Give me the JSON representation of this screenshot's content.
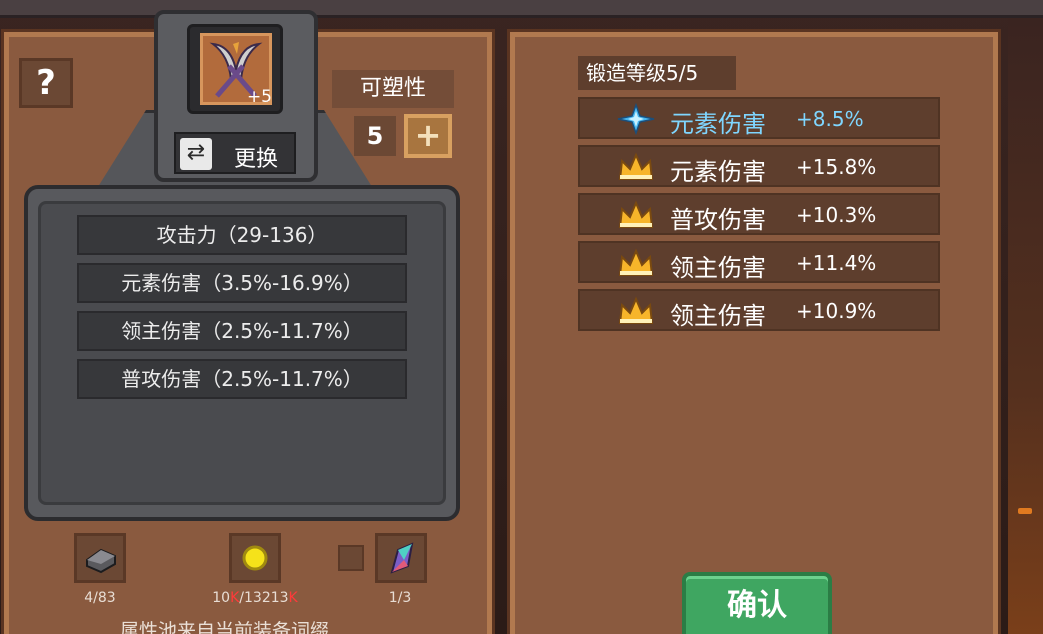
{
  "help": {
    "label": "?"
  },
  "item": {
    "level_badge": "+5",
    "icon": "crossed-scythes-icon"
  },
  "swap": {
    "label": "更换",
    "icon": "swap-arrows-icon"
  },
  "plasticity": {
    "label": "可塑性",
    "value": "5",
    "add_label": "+"
  },
  "attributes": [
    "攻击力（29-136）",
    "元素伤害（3.5%-16.9%）",
    "领主伤害（2.5%-11.7%）",
    "普攻伤害（2.5%-11.7%）"
  ],
  "materials": [
    {
      "icon": "iron-ingot-icon",
      "count": "4/83"
    },
    {
      "icon": "gold-coin-icon",
      "count_main": "10",
      "count_k1": "K",
      "count_mid": "/13213",
      "count_k2": "K"
    },
    {
      "icon": "crystal-icon",
      "count": "1/3"
    }
  ],
  "pool_text": "属性池来自当前装备词缀",
  "forge": {
    "level_label": "锻造等级5/5",
    "bonuses": [
      {
        "icon": "blue-star-icon",
        "name": "元素伤害",
        "value": "+8.5%",
        "color": "#7fd6ff"
      },
      {
        "icon": "crown-icon",
        "name": "元素伤害",
        "value": "+15.8%",
        "color": "#ffffff"
      },
      {
        "icon": "crown-icon",
        "name": "普攻伤害",
        "value": "+10.3%",
        "color": "#ffffff"
      },
      {
        "icon": "crown-icon",
        "name": "领主伤害",
        "value": "+11.4%",
        "color": "#ffffff"
      },
      {
        "icon": "crown-icon",
        "name": "领主伤害",
        "value": "+10.9%",
        "color": "#ffffff"
      }
    ]
  },
  "confirm": {
    "label": "确认"
  }
}
